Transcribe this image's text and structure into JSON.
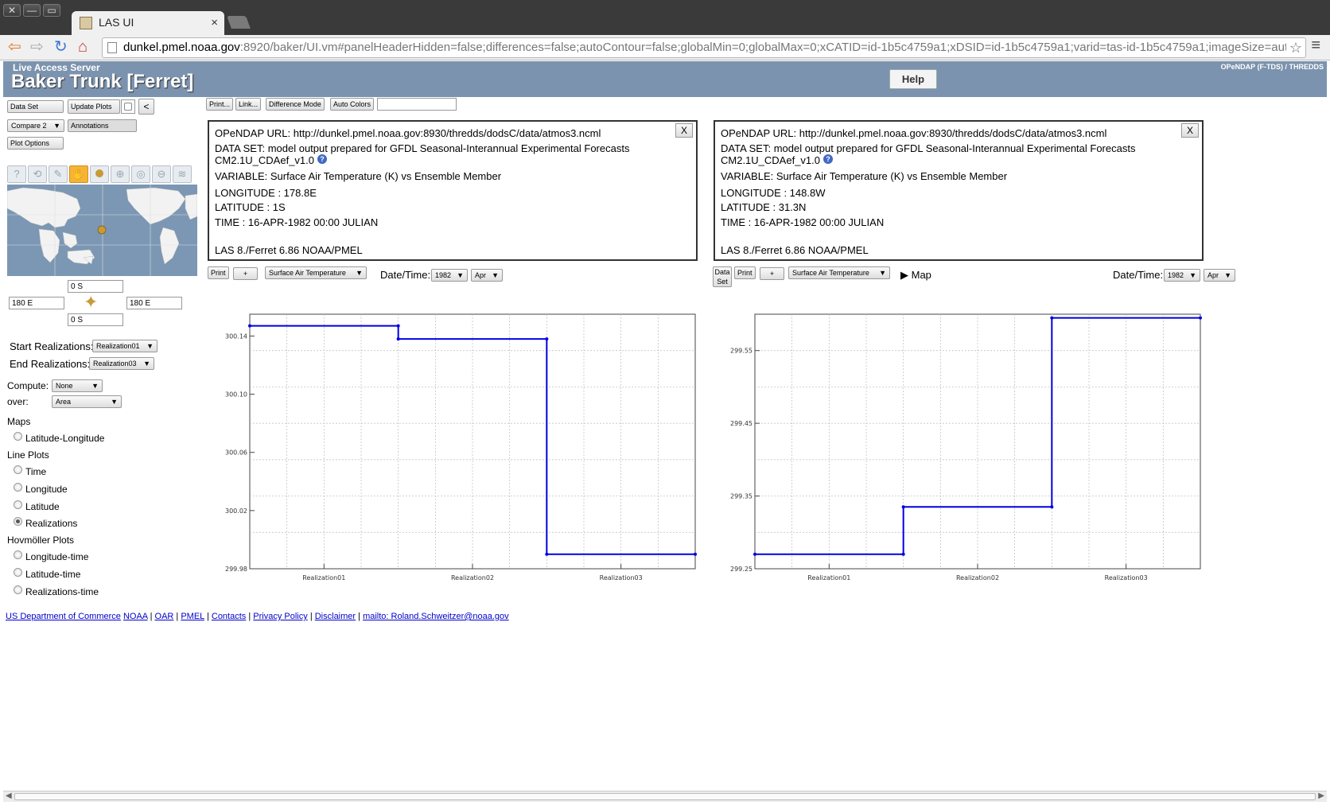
{
  "browser": {
    "tab_title": "LAS UI",
    "tab_close": "×",
    "url_host": "dunkel.pmel.noaa.gov",
    "url_rest": ":8920/baker/UI.vm#panelHeaderHidden=false;differences=false;autoContour=false;globalMin=0;globalMax=0;xCATID=id-1b5c4759a1;xDSID=id-1b5c4759a1;varid=tas-id-1b5c4759a1;imageSize=auto",
    "window_buttons": [
      "✕",
      "—",
      "▭"
    ]
  },
  "header": {
    "las_label": "Live Access Server",
    "title": "Baker Trunk [Ferret]",
    "right_label": "OPeNDAP (F-TDS) / THREDDS",
    "help": "Help"
  },
  "left": {
    "dataset_btn": "Data Set",
    "update_btn": "Update Plots",
    "collapse_btn": "<",
    "compare_sel": "Compare 2",
    "annotations_btn": "Annotations",
    "plot_options_btn": "Plot Options",
    "lat_north": "0 S",
    "lat_south": "0 S",
    "lon_west": "180 E",
    "lon_east": "180 E",
    "start_real_label": "Start Realizations:",
    "start_real_val": "Realization01",
    "end_real_label": "End Realizations:",
    "end_real_val": "Realization03",
    "compute_label": "Compute:",
    "compute_val": "None",
    "over_label": "over:",
    "over_val": "Area",
    "maps_heading": "Maps",
    "latlon": "Latitude-Longitude",
    "line_heading": "Line Plots",
    "time": "Time",
    "longitude": "Longitude",
    "latitude": "Latitude",
    "realizations": "Realizations",
    "hov_heading": "Hovmöller Plots",
    "lon_time": "Longitude-time",
    "lat_time": "Latitude-time",
    "real_time": "Realizations-time",
    "selected_plot": "Realizations"
  },
  "top_toolbar": {
    "print": "Print...",
    "link": "Link...",
    "diff": "Difference Mode",
    "auto": "Auto Colors"
  },
  "panels": [
    {
      "url": "OPeNDAP URL: http://dunkel.pmel.noaa.gov:8930/thredds/dodsC/data/atmos3.ncml",
      "dataset1": "DATA SET: model output prepared for GFDL Seasonal-Interannual Experimental Forecasts",
      "dataset2": "CM2.1U_CDAef_v1.0",
      "variable": "VARIABLE: Surface Air Temperature (K) vs Ensemble Member",
      "lon": "LONGITUDE : 178.8E",
      "lat": "LATITUDE : 1S",
      "time": "TIME : 16-APR-1982 00:00 JULIAN",
      "footer": "LAS 8./Ferret 6.86 NOAA/PMEL",
      "close": "X",
      "print": "Print",
      "plus": "+",
      "variable_sel": "Surface Air Temperature",
      "datetime_label": "Date/Time:",
      "year": "1982",
      "month": "Apr"
    },
    {
      "url": "OPeNDAP URL: http://dunkel.pmel.noaa.gov:8930/thredds/dodsC/data/atmos3.ncml",
      "dataset1": "DATA SET: model output prepared for GFDL Seasonal-Interannual Experimental Forecasts",
      "dataset2": "CM2.1U_CDAef_v1.0",
      "variable": "VARIABLE: Surface Air Temperature (K) vs Ensemble Member",
      "lon": "LONGITUDE : 148.8W",
      "lat": "LATITUDE : 31.3N",
      "time": "TIME : 16-APR-1982 00:00 JULIAN",
      "footer": "LAS 8./Ferret 6.86 NOAA/PMEL",
      "close": "X",
      "dataset_btn_1": "Data",
      "dataset_btn_2": "Set",
      "print": "Print",
      "plus": "+",
      "variable_sel": "Surface Air Temperature",
      "map_label": "Map",
      "datetime_label": "Date/Time:",
      "year": "1982",
      "month": "Apr"
    }
  ],
  "footer_links": [
    "US Department of Commerce",
    "NOAA",
    "OAR",
    "PMEL",
    "Contacts",
    "Privacy Policy",
    "Disclaimer",
    "mailto: Roland.Schweitzer@noaa.gov"
  ],
  "colors": {
    "header_bg": "#7b93ae",
    "line": "#0000e0",
    "map_ocean": "#7b97b4",
    "active_tool": "#f5b436"
  },
  "chart_data": [
    {
      "type": "line",
      "step": true,
      "categories": [
        "Realization01",
        "Realization02",
        "Realization03"
      ],
      "series": [
        {
          "values": [
            300.147,
            300.138,
            299.99
          ]
        }
      ],
      "yticks": [
        "299.98",
        "300.02",
        "300.06",
        "300.10",
        "300.14"
      ],
      "ylim": [
        299.98,
        300.155
      ],
      "grid": true
    },
    {
      "type": "line",
      "step": true,
      "categories": [
        "Realization01",
        "Realization02",
        "Realization03"
      ],
      "series": [
        {
          "values": [
            299.27,
            299.335,
            299.595
          ]
        }
      ],
      "yticks": [
        "299.25",
        "299.35",
        "299.45",
        "299.55"
      ],
      "ylim": [
        299.25,
        299.6
      ],
      "grid": true
    }
  ]
}
